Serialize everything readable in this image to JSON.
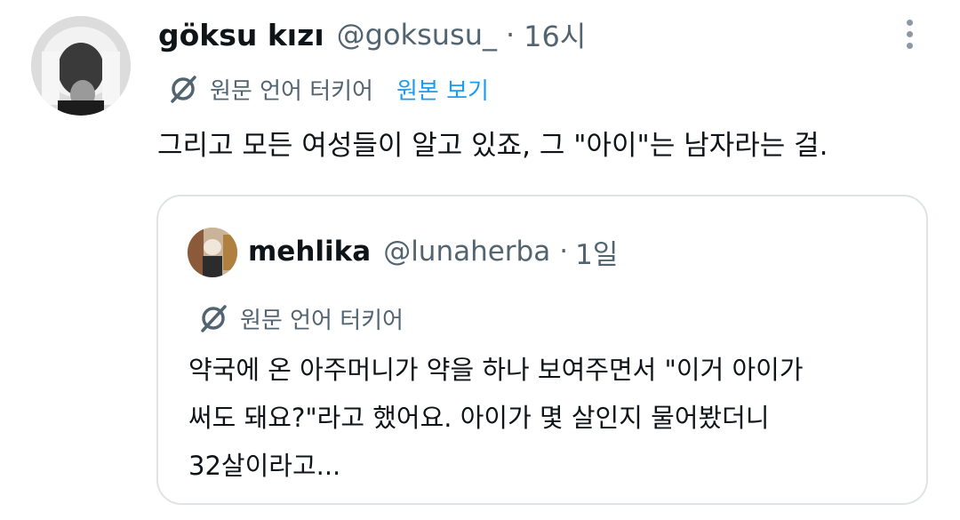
{
  "tweet": {
    "author_name": "göksu kızı",
    "author_handle": "@goksusu_",
    "separator": "·",
    "time": "16시",
    "translated_label": "원문 언어 터키어",
    "show_original_label": "원본 보기",
    "text": "그리고 모든 여성들이 알고 있죠, 그 \"아이\"는 남자라는 걸."
  },
  "quote": {
    "author_name": "mehlika",
    "author_handle": "@lunaherba",
    "separator": "·",
    "time": "1일",
    "translated_label": "원문 언어 터키어",
    "text_lines": [
      "약국에 온 아주머니가 약을 하나 보여주면서 \"이거 아이가",
      "써도 돼요?\"라고 했어요. 아이가 몇 살인지 물어봤더니",
      "32살이라고..."
    ]
  },
  "icons": {
    "translate": "translate-globe-icon",
    "more": "more-options-icon"
  },
  "colors": {
    "text_primary": "#0f1419",
    "text_secondary": "#536471",
    "link": "#1d9bf0",
    "border": "#dfe3e6"
  }
}
